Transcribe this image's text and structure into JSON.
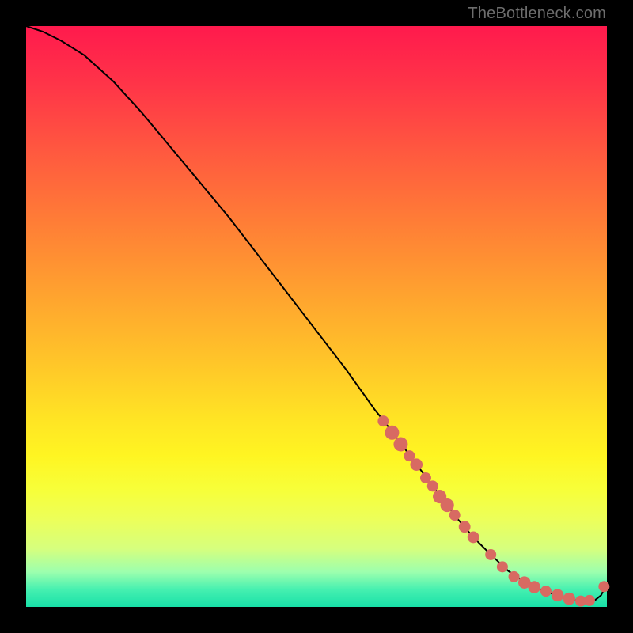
{
  "watermark": "TheBottleneck.com",
  "colors": {
    "curve": "#000000",
    "dot_fill": "#d86a62",
    "dot_stroke": "#c85a55"
  },
  "chart_data": {
    "type": "line",
    "title": "",
    "xlabel": "",
    "ylabel": "",
    "xlim": [
      0,
      100
    ],
    "ylim": [
      0,
      100
    ],
    "grid": false,
    "legend": false,
    "series": [
      {
        "name": "curve",
        "x": [
          0,
          3,
          6,
          10,
          15,
          20,
          25,
          30,
          35,
          40,
          45,
          50,
          55,
          60,
          62,
          65,
          68,
          71,
          74,
          77,
          80,
          83,
          86,
          89,
          92,
          94,
          96,
          98,
          99,
          100
        ],
        "y": [
          100,
          99,
          97.5,
          95,
          90.5,
          85,
          79,
          73,
          67,
          60.5,
          54,
          47.5,
          41,
          34,
          31.5,
          27.5,
          23.5,
          19.5,
          15.5,
          12,
          9,
          6.2,
          4.2,
          2.8,
          1.8,
          1.2,
          1.0,
          1.2,
          2.0,
          4.0
        ]
      }
    ],
    "dots": [
      {
        "x": 61.5,
        "y": 32.0,
        "r": 1.0
      },
      {
        "x": 63.0,
        "y": 30.0,
        "r": 1.5
      },
      {
        "x": 64.5,
        "y": 28.0,
        "r": 1.5
      },
      {
        "x": 66.0,
        "y": 26.0,
        "r": 1.0
      },
      {
        "x": 67.2,
        "y": 24.5,
        "r": 1.2
      },
      {
        "x": 68.8,
        "y": 22.2,
        "r": 1.0
      },
      {
        "x": 70.0,
        "y": 20.8,
        "r": 1.0
      },
      {
        "x": 71.2,
        "y": 19.0,
        "r": 1.4
      },
      {
        "x": 72.5,
        "y": 17.5,
        "r": 1.4
      },
      {
        "x": 73.8,
        "y": 15.8,
        "r": 1.0
      },
      {
        "x": 75.5,
        "y": 13.8,
        "r": 1.1
      },
      {
        "x": 77.0,
        "y": 12.0,
        "r": 1.1
      },
      {
        "x": 80.0,
        "y": 9.0,
        "r": 1.0
      },
      {
        "x": 82.0,
        "y": 6.9,
        "r": 1.0
      },
      {
        "x": 84.0,
        "y": 5.2,
        "r": 1.0
      },
      {
        "x": 85.8,
        "y": 4.2,
        "r": 1.2
      },
      {
        "x": 87.5,
        "y": 3.4,
        "r": 1.2
      },
      {
        "x": 89.5,
        "y": 2.7,
        "r": 1.0
      },
      {
        "x": 91.5,
        "y": 2.0,
        "r": 1.2
      },
      {
        "x": 93.5,
        "y": 1.4,
        "r": 1.2
      },
      {
        "x": 95.5,
        "y": 1.0,
        "r": 1.0
      },
      {
        "x": 97.0,
        "y": 1.1,
        "r": 1.0
      },
      {
        "x": 99.5,
        "y": 3.5,
        "r": 1.0
      }
    ]
  }
}
